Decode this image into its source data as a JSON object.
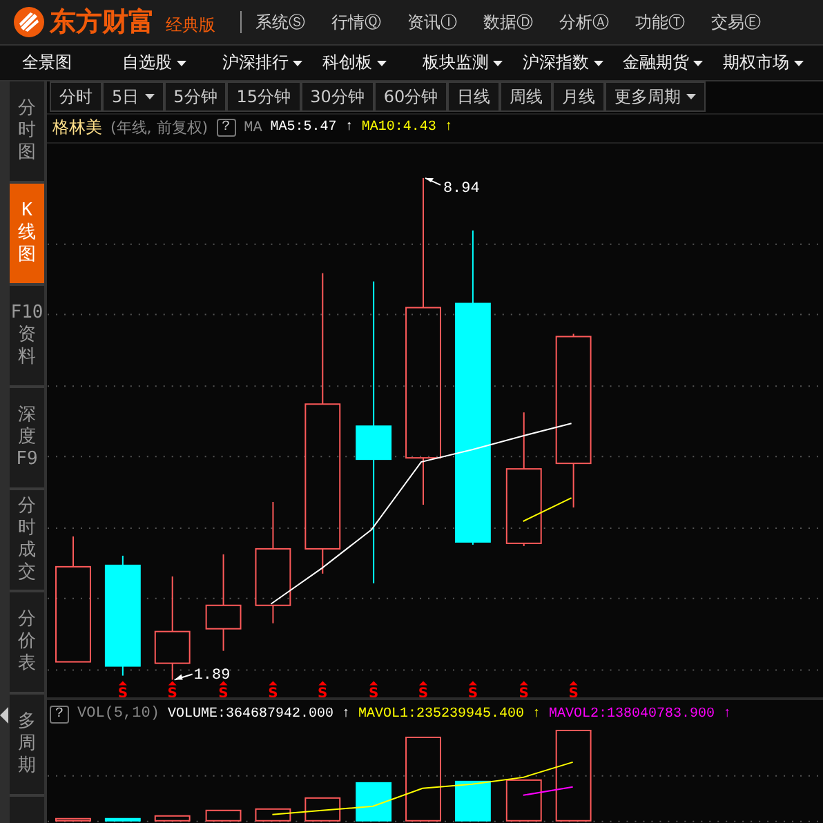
{
  "app": {
    "brand": "东方财富",
    "edition": "经典版"
  },
  "menu": [
    "系统Ⓢ",
    "行情Ⓠ",
    "资讯Ⓘ",
    "数据Ⓓ",
    "分析Ⓐ",
    "功能Ⓣ",
    "交易Ⓔ"
  ],
  "nav": [
    {
      "label": "全景图",
      "dropdown": false
    },
    {
      "label": "自选股",
      "dropdown": true
    },
    {
      "label": "沪深排行",
      "dropdown": true
    },
    {
      "label": "科创板",
      "dropdown": true
    },
    {
      "label": "板块监测",
      "dropdown": true
    },
    {
      "label": "沪深指数",
      "dropdown": true
    },
    {
      "label": "金融期货",
      "dropdown": true
    },
    {
      "label": "期权市场",
      "dropdown": true
    }
  ],
  "sidebar": [
    {
      "lines": [
        "分",
        "时",
        "图"
      ],
      "selected": false
    },
    {
      "lines": [
        "K",
        "线",
        "图"
      ],
      "selected": true
    },
    {
      "lines": [
        "F10",
        "资",
        "料"
      ],
      "selected": false
    },
    {
      "lines": [
        "深",
        "度",
        "F9"
      ],
      "selected": false
    },
    {
      "lines": [
        "分",
        "时",
        "成",
        "交"
      ],
      "selected": false
    },
    {
      "lines": [
        "分",
        "价",
        "表"
      ],
      "selected": false
    },
    {
      "lines": [
        "多",
        "周",
        "期"
      ],
      "selected": false
    }
  ],
  "periods": [
    {
      "label": "分时",
      "dropdown": false
    },
    {
      "label": "5日",
      "dropdown": true
    },
    {
      "label": "5分钟",
      "dropdown": false
    },
    {
      "label": "15分钟",
      "dropdown": false
    },
    {
      "label": "30分钟",
      "dropdown": false
    },
    {
      "label": "60分钟",
      "dropdown": false
    },
    {
      "label": "日线",
      "dropdown": false
    },
    {
      "label": "周线",
      "dropdown": false
    },
    {
      "label": "月线",
      "dropdown": false
    },
    {
      "label": "更多周期",
      "dropdown": true
    }
  ],
  "chart": {
    "stock": "格林美",
    "mode": "(年线, 前复权)",
    "help": "?",
    "indicator": "MA",
    "values": [
      {
        "text": "MA5:5.47",
        "arrow": "↑",
        "color": "#ffffff"
      },
      {
        "text": "MA10:4.43",
        "arrow": "↑",
        "color": "#ffff00"
      }
    ],
    "high_label": "8.94",
    "low_label": "1.89",
    "signals": [
      "S",
      "S",
      "S",
      "S",
      "S",
      "S",
      "S",
      "S",
      "S",
      "S"
    ]
  },
  "volume": {
    "help": "?",
    "indicator": "VOL(5,10)",
    "values": [
      {
        "text": "VOLUME:364687942.000",
        "arrow": "↑",
        "color": "#ffffff"
      },
      {
        "text": "MAVOL1:235239945.400",
        "arrow": "↑",
        "color": "#ffff00"
      },
      {
        "text": "MAVOL2:138040783.900",
        "arrow": "↑",
        "color": "#ff00ff"
      }
    ]
  }
}
